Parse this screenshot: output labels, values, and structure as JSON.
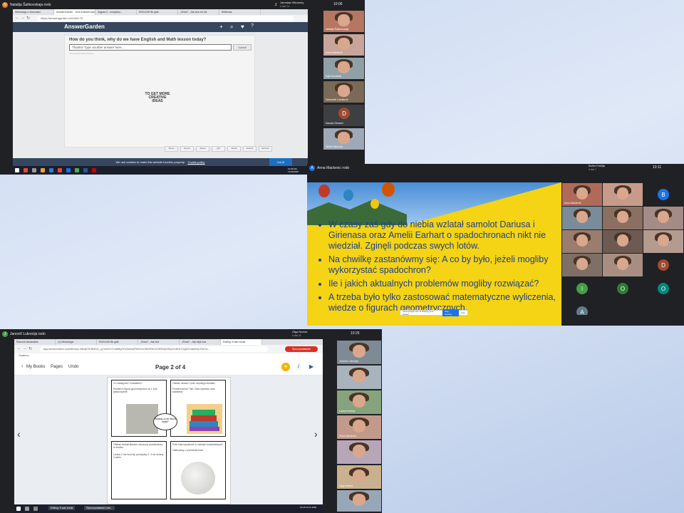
{
  "top_left": {
    "presenter": "Natalija Šaškovskaja rodo",
    "presenter_initial": "N",
    "top_right_name": "Jarosław Wincenty",
    "top_right_sub": "ir dar 14",
    "top_right_initial": "J",
    "time": "10:06",
    "tabs": [
      "Informacja z obecności",
      "AnswerGarden - Give AnswerGarden",
      "Zajęcia 2 - mokyklos...",
      "ENGLISH 8b gidk",
      "„Shwrl“ - Jak duž nie bis",
      "Reflectus"
    ],
    "address": "https://answergarden.ch/1164170",
    "app_name": "AnswerGarden",
    "question": "How do you think, why do we have English and Math lesson today?",
    "input_placeholder": "Thanks! Type another answer here...",
    "submit": "Submit",
    "sub_note": "No AnswerGarden before...",
    "cloud_text": "TO GET MORE CREATIVE IDEAS",
    "bottom_buttons": [
      "Share",
      "Export",
      "Reset",
      "QR",
      "Email",
      "Embed",
      "Refresh"
    ],
    "share_bar": "meet.google.com is sharing your screen",
    "stop_sharing": "Stop sharing",
    "hide": "Hide",
    "cookie_text": "We use cookies to make this website function properly.",
    "cookie_link": "Cookie policy",
    "got_it": "Got it!",
    "activate": "Activate Windows",
    "clock": "10:06 AM 11/24/2020",
    "participants": [
      {
        "name": "Natalija Šaškovskaja",
        "kind": "face"
      },
      {
        "name": "Anna Mackevič",
        "kind": "face"
      },
      {
        "name": "Eglė Kovalčuk",
        "kind": "face"
      },
      {
        "name": "Deimantė Lukoševič",
        "kind": "face"
      },
      {
        "name": "Danuta Gerdzer",
        "kind": "letter",
        "letter": "D"
      },
      {
        "name": "Nikita Viktorova",
        "kind": "face"
      }
    ]
  },
  "middle_right": {
    "presenter": "Anna Mackevic rodo",
    "presenter_initial": "A",
    "top_right_name": "Bolim Emilija",
    "top_right_sub": "ir dar 7",
    "time": "10:11",
    "bullets": [
      "W czasy zaś gdy do niebia wzlatał samolot Dariusa i Girienasa oraz Amelii Earhart o spadochronach nikt nie wiedział. Zginęli podczas swych lotów.",
      "Na chwilkę zastanówmy się: A co by było, jeżeli mogliby wykorzystać spadochron?",
      "Ile i jakich aktualnych problemów mogliby rozwiązać?",
      "A trzeba było tylko zastosować matematyczne wyliczenia, wiedze o figurach geometrycznych."
    ],
    "share_bar": "meet.google.com is sharing your screen",
    "stop_sharing": "Stop sharing",
    "hide": "Hide",
    "participants": [
      {
        "kind": "face",
        "name": "Anna Mackevič"
      },
      {
        "kind": "face",
        "name": ""
      },
      {
        "kind": "letter",
        "letter": "B",
        "color": "#1a73e8"
      },
      {
        "kind": "face",
        "name": ""
      },
      {
        "kind": "face",
        "name": ""
      },
      {
        "kind": "face",
        "name": ""
      },
      {
        "kind": "face",
        "name": ""
      },
      {
        "kind": "face",
        "name": ""
      },
      {
        "kind": "face",
        "name": ""
      },
      {
        "kind": "face",
        "name": ""
      },
      {
        "kind": "face",
        "name": ""
      },
      {
        "kind": "letter",
        "letter": "D",
        "color": "#a04b2f"
      },
      {
        "kind": "letter",
        "letter": "I",
        "color": "#43a047"
      },
      {
        "kind": "letter",
        "letter": "O",
        "color": "#2e7d32"
      },
      {
        "kind": "letter",
        "letter": "O",
        "color": "#00897b"
      },
      {
        "kind": "letter",
        "letter": "A",
        "color": "#607d8b"
      }
    ]
  },
  "bottom_left": {
    "presenter": "Janovič Lukrecija rodo",
    "presenter_initial": "J",
    "top_right_name": "Olga Nerkut",
    "top_right_sub": "ir dar 11",
    "time": "10:25",
    "tabs": [
      "Rokvinė kantaraktis",
      "(1) Messenger",
      "ENGLISH 8b gidk",
      "„Shwrl“ - Jak duž",
      "„Shwrl“ - Jak mlyb kvs",
      "Editing: It wav bould"
    ],
    "address": "app.bookcreator.com/library/-MIcjE2f-Bnfh/1_g7sr02U7/vdb8gYHQsdbAPhEDvO9bDRK2/XRfGj/lOfQc/X4KKJ/QjZZ/uay/tcip7b/Ca...",
    "profile": "Прослушивание",
    "bookmark": "Сервисы",
    "nav_my_books": "My Books",
    "nav_pages": "Pages",
    "nav_undo": "Undo",
    "page_indicator": "Page 2 of 4",
    "comic_panels": {
      "p1_title": "Co następnie? Kształtem?",
      "p1_text": "Kształt to figura geometryczna na 1 bok płaszczyźnie",
      "p2_title": "Obłość obszar? pole czystego kształtu",
      "p2_text": "Powierzchnia? Tak. Dwa wymiary oraz kształtów",
      "bubble": "Słuchaj, co on ma na myśli?",
      "p3_title": "Obłość kształt literami otoczony przestrzenią w środku",
      "p3_text": "Liczba 2 łuk boczny, pomiędzy 2 i 3 ze ściany 4 wielu",
      "p4_title": "Pole koła wyrażone w metrach kwadratowych",
      "p4_text": "Obliczamy z promienia koła"
    },
    "clock": "10:25 24.11.2020",
    "taskbar_apps": [
      "Editing: It was bould",
      "Прослушивание (тип..."
    ],
    "participants": [
      {
        "name": "Janović Lukrecija",
        "kind": "face"
      },
      {
        "name": "",
        "kind": "face"
      },
      {
        "name": "Larisa Karlova",
        "kind": "face"
      },
      {
        "name": "Anna Mackevič",
        "kind": "face"
      },
      {
        "name": "",
        "kind": "face"
      },
      {
        "name": "Olga Nerkut",
        "kind": "face"
      },
      {
        "name": "",
        "kind": "face"
      }
    ]
  },
  "colors": {
    "meet_dark": "#202124",
    "slide_yellow": "#f5d315",
    "slide_text": "#1c3f8a",
    "answergarden_blue": "#35465e"
  }
}
